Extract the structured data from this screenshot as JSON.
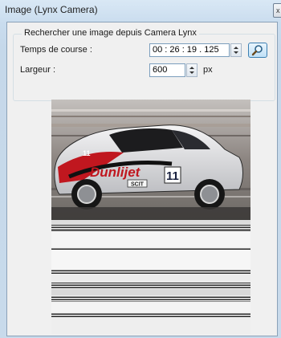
{
  "window": {
    "title": "Image (Lynx Camera)",
    "close_glyph": "x"
  },
  "group": {
    "legend": "Rechercher une image depuis Camera Lynx"
  },
  "fields": {
    "race_time": {
      "label": "Temps de course :",
      "value": "00 : 26 : 19 . 125"
    },
    "width": {
      "label": "Largeur :",
      "value": "600",
      "unit": "px"
    }
  },
  "icons": {
    "search": "magnifier-icon",
    "close": "close-icon"
  },
  "colors": {
    "accent_blue": "#3c7fb1",
    "car_red": "#c0171f"
  },
  "image": {
    "car_number": "11",
    "sponsor": "Dunlijet",
    "door_text": "SCIT"
  }
}
